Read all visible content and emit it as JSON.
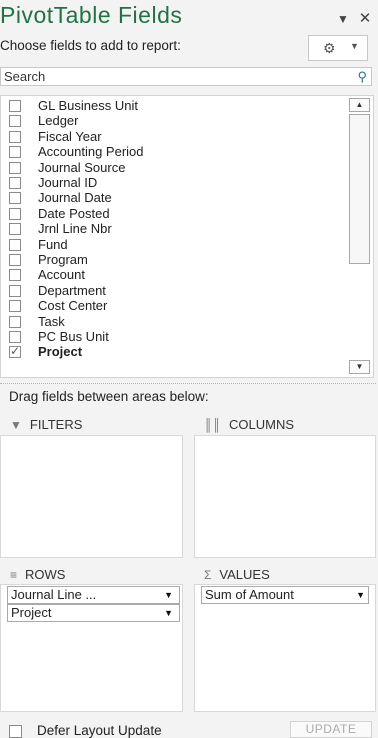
{
  "pane": {
    "title": "PivotTable Fields",
    "subtitle": "Choose fields to add to report:",
    "header_buttons": [
      "chevron-down-icon",
      "close-icon"
    ]
  },
  "search": {
    "placeholder": "Search",
    "value": ""
  },
  "fields": [
    {
      "label": "GL Business Unit",
      "checked": false
    },
    {
      "label": "Ledger",
      "checked": false
    },
    {
      "label": "Fiscal Year",
      "checked": false
    },
    {
      "label": "Accounting Period",
      "checked": false
    },
    {
      "label": "Journal Source",
      "checked": false
    },
    {
      "label": "Journal ID",
      "checked": false
    },
    {
      "label": "Journal Date",
      "checked": false
    },
    {
      "label": "Date Posted",
      "checked": false
    },
    {
      "label": "Jrnl Line Nbr",
      "checked": false
    },
    {
      "label": "Fund",
      "checked": false
    },
    {
      "label": "Program",
      "checked": false
    },
    {
      "label": "Account",
      "checked": false
    },
    {
      "label": "Department",
      "checked": false
    },
    {
      "label": "Cost Center",
      "checked": false
    },
    {
      "label": "Task",
      "checked": false
    },
    {
      "label": "PC Bus Unit",
      "checked": false
    },
    {
      "label": "Project",
      "checked": true
    }
  ],
  "areas": {
    "drag_label": "Drag fields between areas below:",
    "filters": {
      "label": "FILTERS",
      "items": []
    },
    "columns": {
      "label": "COLUMNS",
      "items": []
    },
    "rows": {
      "label": "ROWS",
      "items": [
        "Journal Line ...",
        "Project"
      ]
    },
    "values": {
      "label": "VALUES",
      "icon_glyph": "Σ",
      "items": [
        "Sum of Amount"
      ]
    }
  },
  "footer": {
    "defer_label": "Defer Layout Update",
    "defer_checked": false,
    "update_label": "UPDATE"
  },
  "colors": {
    "title": "#217346",
    "pane_bg": "#f3f3f3"
  }
}
